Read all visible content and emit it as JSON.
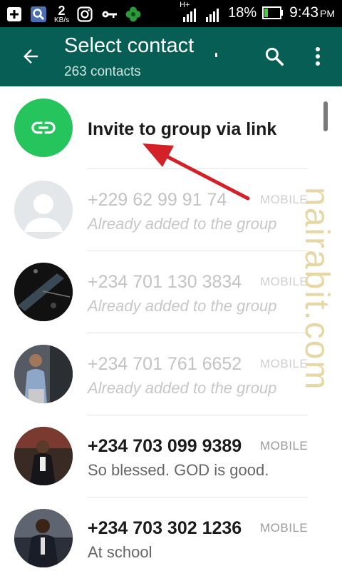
{
  "status_bar": {
    "speed_value": "2",
    "speed_unit": "KB/s",
    "network_type": "H+",
    "battery": "18%",
    "time": "9:43",
    "ampm": "PM",
    "icons": [
      "plus-square-icon",
      "search-square-icon",
      "instagram-icon",
      "key-icon",
      "clover-icon",
      "signal-icon",
      "signal-icon",
      "battery-icon"
    ]
  },
  "app_bar": {
    "title": "Select contact",
    "subtitle": "263 contacts",
    "icons": [
      "back-arrow-icon",
      "search-icon",
      "more-vert-icon"
    ]
  },
  "invite": {
    "label": "Invite to group via link",
    "icon": "link-icon",
    "icon_bg": "#25c45c"
  },
  "contacts": [
    {
      "name": "+229 62 99 91 74",
      "type": "MOBILE",
      "status": "Already added to the group",
      "added": true,
      "avatar": "default-avatar-icon"
    },
    {
      "name": "+234 701 130 3834",
      "type": "MOBILE",
      "status": "Already added to the group",
      "added": true,
      "avatar": "photo"
    },
    {
      "name": "+234 701 761 6652",
      "type": "MOBILE",
      "status": "Already added to the group",
      "added": true,
      "avatar": "photo"
    },
    {
      "name": "+234 703 099 9389",
      "type": "MOBILE",
      "status": "So blessed. GOD is good.",
      "added": false,
      "avatar": "photo"
    },
    {
      "name": "+234 703 302 1236",
      "type": "MOBILE",
      "status": "At school",
      "added": false,
      "avatar": "photo"
    }
  ],
  "watermark": "nairabit.com",
  "colors": {
    "app_bar": "#075e54",
    "accent_green": "#25c45c",
    "annotation_arrow": "#d42027"
  }
}
